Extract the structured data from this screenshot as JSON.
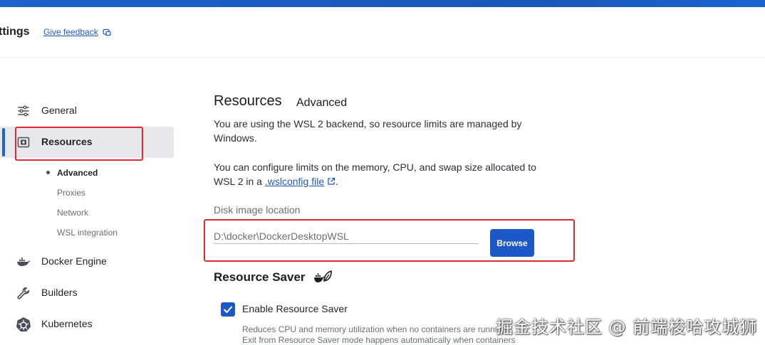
{
  "header": {
    "title": "ttings",
    "feedback_label": "Give feedback"
  },
  "sidebar": {
    "items": [
      {
        "label": "General",
        "icon": "sliders-icon"
      },
      {
        "label": "Resources",
        "icon": "resources-icon"
      },
      {
        "label": "Docker Engine",
        "icon": "whale-icon"
      },
      {
        "label": "Builders",
        "icon": "wrench-icon"
      },
      {
        "label": "Kubernetes",
        "icon": "helm-wheel-icon"
      }
    ],
    "subitems": [
      "Advanced",
      "Proxies",
      "Network",
      "WSL integration"
    ]
  },
  "main": {
    "title": "Resources",
    "active_tab": "Advanced",
    "para1": "You are using the WSL 2 backend, so resource limits are managed by Windows.",
    "para2_prefix": "You can configure limits on the memory, CPU, and swap size allocated to WSL 2 in a",
    "para2_link": ".wslconfig file",
    "para2_suffix": ".",
    "disk_label": "Disk image location",
    "disk_value": "D:\\docker\\DockerDesktopWSL",
    "browse_label": "Browse",
    "saver_title": "Resource Saver",
    "saver_checkbox_label": "Enable Resource Saver",
    "saver_checked": true,
    "saver_desc1": "Reduces CPU and memory utilization when no containers are running.",
    "saver_desc2": "Exit from Resource Saver mode happens automatically when containers"
  },
  "watermark": "掘金技术社区 @ 前端梭哈攻城狮",
  "colors": {
    "accent": "#1d63c9",
    "button": "#1c59c7",
    "highlight_box": "#e0282e",
    "active_bg": "#e7e8eb"
  }
}
